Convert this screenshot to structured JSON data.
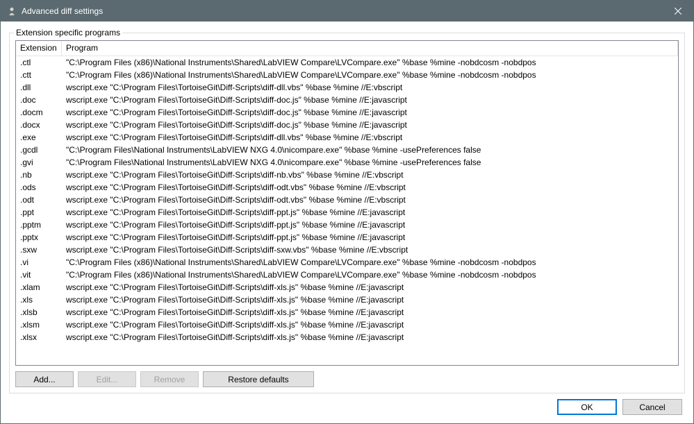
{
  "window": {
    "title": "Advanced diff settings"
  },
  "group": {
    "label": "Extension specific programs"
  },
  "columns": {
    "extension": "Extension",
    "program": "Program"
  },
  "rows": [
    {
      "ext": ".ctl",
      "prog": "\"C:\\Program Files (x86)\\National Instruments\\Shared\\LabVIEW Compare\\LVCompare.exe\" %base %mine -nobdcosm -nobdpos"
    },
    {
      "ext": ".ctt",
      "prog": "\"C:\\Program Files (x86)\\National Instruments\\Shared\\LabVIEW Compare\\LVCompare.exe\" %base %mine -nobdcosm -nobdpos"
    },
    {
      "ext": ".dll",
      "prog": "wscript.exe \"C:\\Program Files\\TortoiseGit\\Diff-Scripts\\diff-dll.vbs\" %base %mine //E:vbscript"
    },
    {
      "ext": ".doc",
      "prog": "wscript.exe \"C:\\Program Files\\TortoiseGit\\Diff-Scripts\\diff-doc.js\" %base %mine //E:javascript"
    },
    {
      "ext": ".docm",
      "prog": "wscript.exe \"C:\\Program Files\\TortoiseGit\\Diff-Scripts\\diff-doc.js\" %base %mine //E:javascript"
    },
    {
      "ext": ".docx",
      "prog": "wscript.exe \"C:\\Program Files\\TortoiseGit\\Diff-Scripts\\diff-doc.js\" %base %mine //E:javascript"
    },
    {
      "ext": ".exe",
      "prog": "wscript.exe \"C:\\Program Files\\TortoiseGit\\Diff-Scripts\\diff-dll.vbs\" %base %mine //E:vbscript"
    },
    {
      "ext": ".gcdl",
      "prog": "\"C:\\Program Files\\National Instruments\\LabVIEW NXG 4.0\\nicompare.exe\" %base %mine -usePreferences false"
    },
    {
      "ext": ".gvi",
      "prog": "\"C:\\Program Files\\National Instruments\\LabVIEW NXG 4.0\\nicompare.exe\" %base %mine -usePreferences false"
    },
    {
      "ext": ".nb",
      "prog": "wscript.exe \"C:\\Program Files\\TortoiseGit\\Diff-Scripts\\diff-nb.vbs\" %base %mine //E:vbscript"
    },
    {
      "ext": ".ods",
      "prog": "wscript.exe \"C:\\Program Files\\TortoiseGit\\Diff-Scripts\\diff-odt.vbs\" %base %mine //E:vbscript"
    },
    {
      "ext": ".odt",
      "prog": "wscript.exe \"C:\\Program Files\\TortoiseGit\\Diff-Scripts\\diff-odt.vbs\" %base %mine //E:vbscript"
    },
    {
      "ext": ".ppt",
      "prog": "wscript.exe \"C:\\Program Files\\TortoiseGit\\Diff-Scripts\\diff-ppt.js\" %base %mine //E:javascript"
    },
    {
      "ext": ".pptm",
      "prog": "wscript.exe \"C:\\Program Files\\TortoiseGit\\Diff-Scripts\\diff-ppt.js\" %base %mine //E:javascript"
    },
    {
      "ext": ".pptx",
      "prog": "wscript.exe \"C:\\Program Files\\TortoiseGit\\Diff-Scripts\\diff-ppt.js\" %base %mine //E:javascript"
    },
    {
      "ext": ".sxw",
      "prog": "wscript.exe \"C:\\Program Files\\TortoiseGit\\Diff-Scripts\\diff-sxw.vbs\" %base %mine //E:vbscript"
    },
    {
      "ext": ".vi",
      "prog": "\"C:\\Program Files (x86)\\National Instruments\\Shared\\LabVIEW Compare\\LVCompare.exe\" %base %mine -nobdcosm -nobdpos"
    },
    {
      "ext": ".vit",
      "prog": "\"C:\\Program Files (x86)\\National Instruments\\Shared\\LabVIEW Compare\\LVCompare.exe\" %base %mine -nobdcosm -nobdpos"
    },
    {
      "ext": ".xlam",
      "prog": "wscript.exe \"C:\\Program Files\\TortoiseGit\\Diff-Scripts\\diff-xls.js\" %base %mine //E:javascript"
    },
    {
      "ext": ".xls",
      "prog": "wscript.exe \"C:\\Program Files\\TortoiseGit\\Diff-Scripts\\diff-xls.js\" %base %mine //E:javascript"
    },
    {
      "ext": ".xlsb",
      "prog": "wscript.exe \"C:\\Program Files\\TortoiseGit\\Diff-Scripts\\diff-xls.js\" %base %mine //E:javascript"
    },
    {
      "ext": ".xlsm",
      "prog": "wscript.exe \"C:\\Program Files\\TortoiseGit\\Diff-Scripts\\diff-xls.js\" %base %mine //E:javascript"
    },
    {
      "ext": ".xlsx",
      "prog": "wscript.exe \"C:\\Program Files\\TortoiseGit\\Diff-Scripts\\diff-xls.js\" %base %mine //E:javascript"
    }
  ],
  "buttons": {
    "add": "Add...",
    "edit": "Edit...",
    "remove": "Remove",
    "restore": "Restore defaults",
    "ok": "OK",
    "cancel": "Cancel"
  }
}
